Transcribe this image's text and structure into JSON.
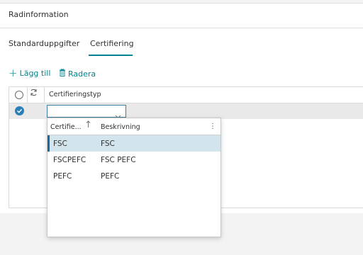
{
  "panel": {
    "title": "Radinformation"
  },
  "tabs": [
    {
      "label": "Standarduppgifter",
      "active": false
    },
    {
      "label": "Certifiering",
      "active": true
    }
  ],
  "actions": {
    "add_label": "Lägg till",
    "delete_label": "Radera"
  },
  "grid": {
    "column_header": "Certifieringstyp",
    "row": {
      "selected": true,
      "value": ""
    }
  },
  "dropdown": {
    "headers": [
      "Certifie...",
      "Beskrivning"
    ],
    "sort_indicator": "ascending",
    "rows": [
      {
        "code": "FSC",
        "description": "FSC",
        "selected": true
      },
      {
        "code": "FSCPEFC",
        "description": "FSC PEFC",
        "selected": false
      },
      {
        "code": "PEFC",
        "description": "PEFC",
        "selected": false
      }
    ]
  },
  "colors": {
    "accent": "#00838f",
    "selected_row": "#d2e4ec",
    "check_fill": "#2b7fb8"
  }
}
